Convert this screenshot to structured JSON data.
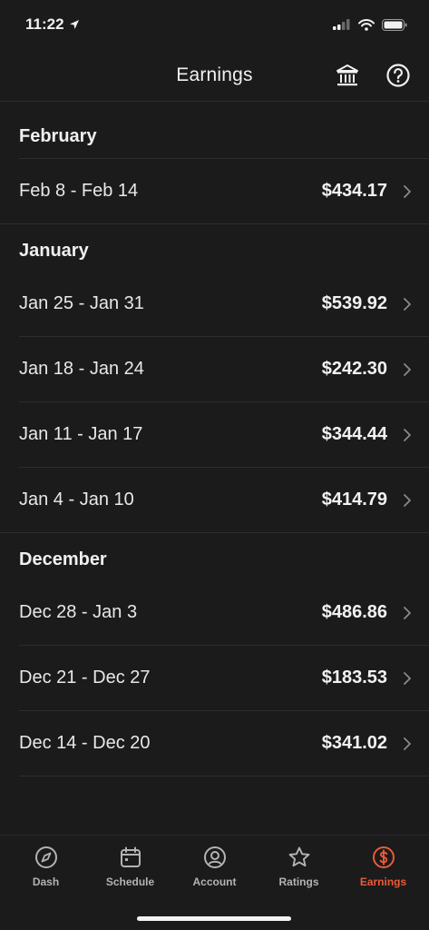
{
  "status": {
    "time": "11:22"
  },
  "header": {
    "title": "Earnings",
    "bank_icon": "bank-icon",
    "help_icon": "help-icon"
  },
  "sections": [
    {
      "title": "February",
      "rows": [
        {
          "range": "Feb 8 - Feb 14",
          "amount": "$434.17"
        }
      ]
    },
    {
      "title": "January",
      "rows": [
        {
          "range": "Jan 25 - Jan 31",
          "amount": "$539.92"
        },
        {
          "range": "Jan 18 - Jan 24",
          "amount": "$242.30"
        },
        {
          "range": "Jan 11 - Jan 17",
          "amount": "$344.44"
        },
        {
          "range": "Jan 4 - Jan 10",
          "amount": "$414.79"
        }
      ]
    },
    {
      "title": "December",
      "rows": [
        {
          "range": "Dec 28 - Jan 3",
          "amount": "$486.86"
        },
        {
          "range": "Dec 21 - Dec 27",
          "amount": "$183.53"
        },
        {
          "range": "Dec 14 - Dec 20",
          "amount": "$341.02"
        }
      ]
    }
  ],
  "tabs": [
    {
      "label": "Dash",
      "icon": "compass-icon",
      "active": false
    },
    {
      "label": "Schedule",
      "icon": "calendar-icon",
      "active": false
    },
    {
      "label": "Account",
      "icon": "person-icon",
      "active": false
    },
    {
      "label": "Ratings",
      "icon": "star-icon",
      "active": false
    },
    {
      "label": "Earnings",
      "icon": "dollar-icon",
      "active": true
    }
  ],
  "colors": {
    "background": "#1b1b1b",
    "accent": "#eb5a3a",
    "divider": "#2e2e2e"
  }
}
